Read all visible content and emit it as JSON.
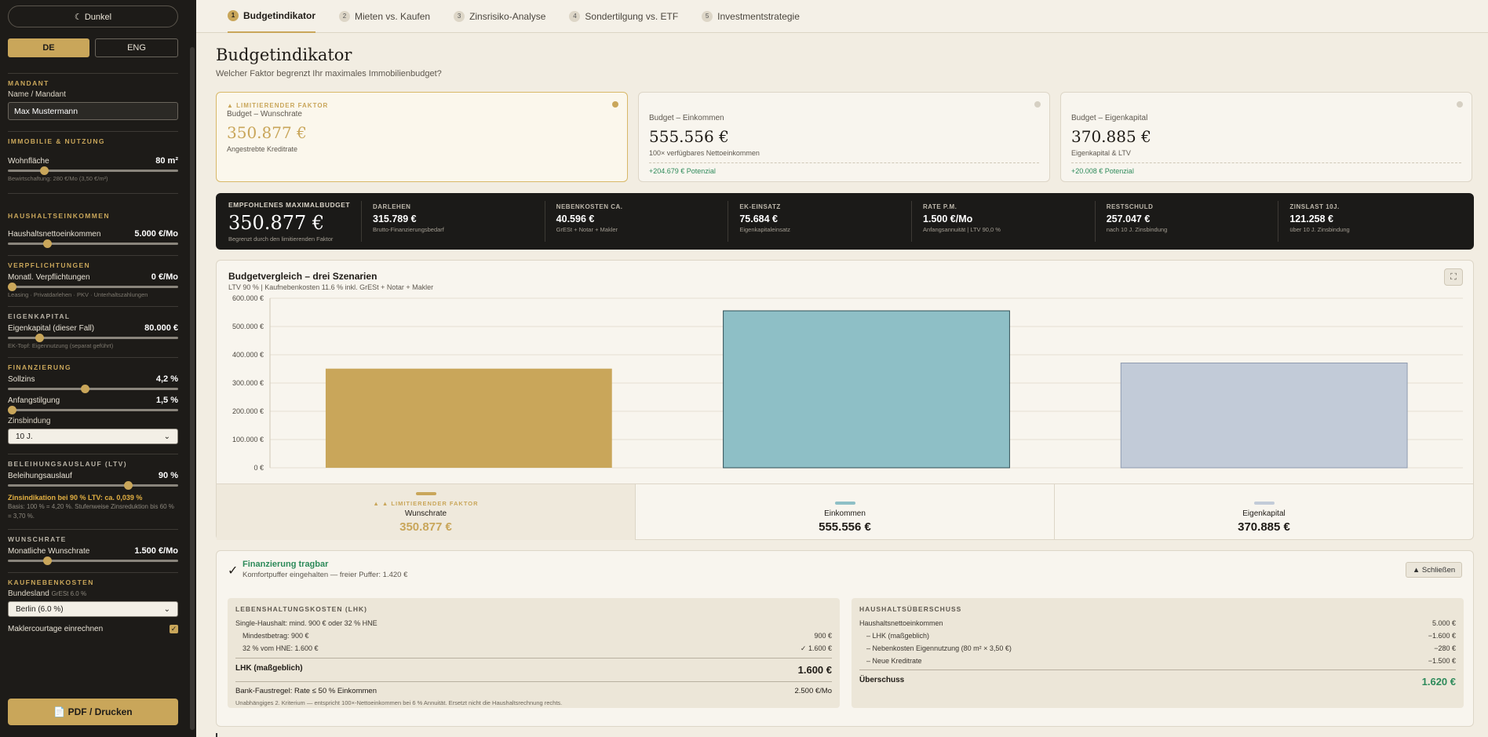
{
  "sidebar": {
    "theme_label": "☾ Dunkel",
    "lang_de": "DE",
    "lang_eng": "ENG",
    "mandant": {
      "title": "MANDANT",
      "label": "Name / Mandant",
      "value": "Max Mustermann"
    },
    "immobilie": {
      "title": "IMMOBILIE & NUTZUNG",
      "label": "Wohnfläche",
      "value": "80 m²",
      "level": 0.2,
      "hint": "Bewirtschaftung: 280 €/Mo (3,50 €/m²)"
    },
    "haushalt": {
      "title": "HAUSHALTSEINKOMMEN",
      "label": "Haushaltsnettoeinkommen",
      "value": "5.000 €/Mo",
      "level": 0.22
    },
    "verpfl": {
      "title": "VERPFLICHTUNGEN",
      "label": "Monatl. Verpflichtungen",
      "value": "0 €/Mo",
      "level": 0.0,
      "hint": "Leasing · Privatdarlehen · PKV · Unterhaltszahlungen"
    },
    "eigenkapital": {
      "title": "EIGENKAPITAL",
      "label": "Eigenkapital (dieser Fall)",
      "value": "80.000 €",
      "level": 0.17,
      "hint": "EK-Topf: Eigennutzung (separat geführt)"
    },
    "finanzierung": {
      "title": "FINANZIERUNG",
      "sollzins_label": "Sollzins",
      "sollzins_value": "4,2 %",
      "sollzins_level": 0.45,
      "tilgung_label": "Anfangstilgung",
      "tilgung_value": "1,5 %",
      "tilgung_level": 0.0,
      "zinsbindung_label": "Zinsbindung",
      "zinsbindung_value": "10 J."
    },
    "ltv": {
      "title": "BELEIHUNGSAUSLAUF (LTV)",
      "label": "Beleihungsauslauf",
      "value": "90 %",
      "level": 0.72,
      "warn": "Zinsindikation bei 90 % LTV: ca. 0,039 %",
      "hint": "Basis: 100 % = 4,20 %. Stufenweise Zinsreduktion bis 60 % = 3,70 %."
    },
    "wunschrate": {
      "title": "WUNSCHRATE",
      "label": "Monatliche Wunschrate",
      "value": "1.500 €/Mo",
      "level": 0.22
    },
    "kaufnk": {
      "title": "KAUFNEBENKOSTEN",
      "label": "Bundesland",
      "label_sub": "GrESt 6.0 %",
      "value": "Berlin (6.0 %)",
      "makler_label": "Maklercourtage einrechnen"
    },
    "pdf_label": "📄 PDF / Drucken"
  },
  "tabs": [
    {
      "num": "1",
      "label": "Budgetindikator"
    },
    {
      "num": "2",
      "label": "Mieten vs. Kaufen"
    },
    {
      "num": "3",
      "label": "Zinsrisiko-Analyse"
    },
    {
      "num": "4",
      "label": "Sondertilgung vs. ETF"
    },
    {
      "num": "5",
      "label": "Investmentstrategie"
    }
  ],
  "page": {
    "title": "Budgetindikator",
    "subtitle": "Welcher Faktor begrenzt Ihr maximales Immobilienbudget?"
  },
  "cards": [
    {
      "tag": "▲ LIMITIERENDER FAKTOR",
      "title": "Budget – Wunschrate",
      "value": "350.877 €",
      "sub": "Angestrebte Kreditrate",
      "potential": ""
    },
    {
      "tag": "",
      "title": "Budget – Einkommen",
      "value": "555.556 €",
      "sub": "100× verfügbares Nettoeinkommen",
      "potential": "+204.679 € Potenzial"
    },
    {
      "tag": "",
      "title": "Budget – Eigenkapital",
      "value": "370.885 €",
      "sub": "Eigenkapital & LTV",
      "potential": "+20.008 € Potenzial"
    }
  ],
  "summary": {
    "main_label": "EMPFOHLENES MAXIMALBUDGET",
    "main_value": "350.877 €",
    "main_sub": "Begrenzt durch den limitierenden Faktor",
    "kpis": [
      {
        "k": "DARLEHEN",
        "v": "315.789 €",
        "s": "Brutto-Finanzierungsbedarf"
      },
      {
        "k": "NEBENKOSTEN CA.",
        "v": "40.596 €",
        "s": "GrESt + Notar + Makler"
      },
      {
        "k": "EK-EINSATZ",
        "v": "75.684 €",
        "s": "Eigenkapitaleinsatz"
      },
      {
        "k": "RATE P.M.",
        "v": "1.500 €/Mo",
        "s": "Anfangsannuität | LTV 90,0 %"
      },
      {
        "k": "RESTSCHULD",
        "v": "257.047 €",
        "s": "nach 10 J. Zinsbindung"
      },
      {
        "k": "ZINSLAST 10J.",
        "v": "121.258 €",
        "s": "über 10 J. Zinsbindung"
      }
    ]
  },
  "chart_section": {
    "title": "Budgetvergleich – drei Szenarien",
    "subtitle": "LTV 90 % | Kaufnebenkosten 11.6 % inkl. GrESt + Notar + Makler"
  },
  "chart_data": {
    "type": "bar",
    "categories": [
      "Wunschrate",
      "Einkommen",
      "Eigenkapital"
    ],
    "values": [
      350877,
      555556,
      370885
    ],
    "colors": [
      "#c9a65a",
      "#8ebfc6",
      "#c2cbd8"
    ],
    "ylim": [
      0,
      600000
    ],
    "yticks": [
      "0 €",
      "100.000 €",
      "200.000 €",
      "300.000 €",
      "400.000 €",
      "500.000 €",
      "600.000 €"
    ],
    "grid": true
  },
  "legend": [
    {
      "tag": "▲ ▲ LIMITIERENDER FAKTOR",
      "name": "Wunschrate",
      "value": "350.877 €"
    },
    {
      "tag": "",
      "name": "Einkommen",
      "value": "555.556 €"
    },
    {
      "tag": "",
      "name": "Eigenkapital",
      "value": "370.885 €"
    }
  ],
  "financing": {
    "check": "✓",
    "title": "Finanzierung tragbar",
    "subtitle": "Komfortpuffer eingehalten — freier Puffer: 1.420 €",
    "close_label": "▲ Schließen",
    "lhk": {
      "title": "LEBENSHALTUNGSKOSTEN (LHK)",
      "intro": "Single-Haushalt: mind. 900 € oder 32 % HNE",
      "rows": [
        {
          "label": "Mindestbetrag: 900 €",
          "value": "900 €"
        },
        {
          "label": "32 % vom HNE: 1.600 €",
          "value": "✓ 1.600 €"
        }
      ],
      "sum_label": "LHK (maßgeblich)",
      "sum_value": "1.600 €",
      "bank_label": "Bank-Faustregel: Rate ≤ 50 % Einkommen",
      "bank_value": "2.500 €/Mo",
      "note": "Unabhängiges 2. Kriterium — entspricht 100×-Nettoeinkommen bei 6 % Annuität. Ersetzt nicht die Haushaltsrechnung rechts."
    },
    "surplus": {
      "title": "HAUSHALTSÜBERSCHUSS",
      "rows": [
        {
          "label": "Haushaltsnettoeinkommen",
          "value": "5.000 €"
        },
        {
          "label": "– LHK (maßgeblich)",
          "value": "−1.600 €"
        },
        {
          "label": "– Nebenkosten Eigennutzung (80 m² × 3,50 €)",
          "value": "−280 €"
        },
        {
          "label": "– Neue Kreditrate",
          "value": "−1.500 €"
        }
      ],
      "sum_label": "Überschuss",
      "sum_value": "1.620 €"
    }
  }
}
